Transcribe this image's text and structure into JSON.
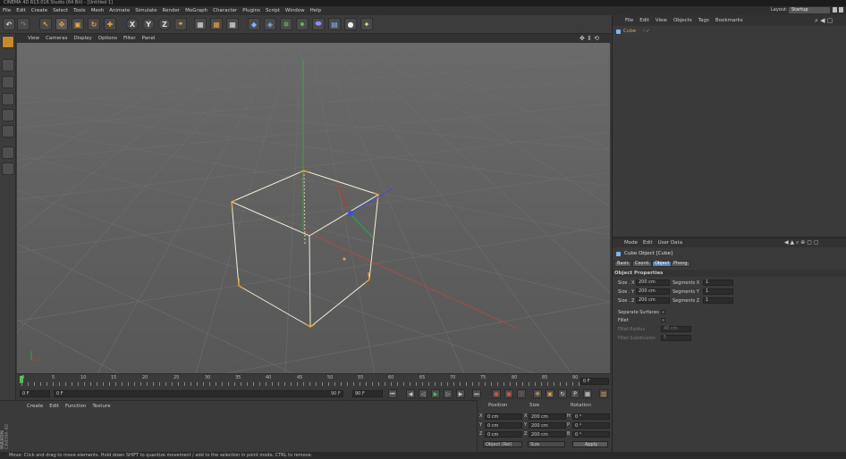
{
  "title_bar": {
    "text": "CINEMA 4D R13.016 Studio (64 Bit) - [Untitled 1]"
  },
  "menu": [
    "File",
    "Edit",
    "Create",
    "Select",
    "Tools",
    "Mesh",
    "Animate",
    "Simulate",
    "Render",
    "MoGraph",
    "Character",
    "Plugins",
    "Script",
    "Window",
    "Help"
  ],
  "layout": {
    "label": "Layout:",
    "value": "Startup"
  },
  "toolbar": {
    "axis_x": "X",
    "axis_y": "Y",
    "axis_z": "Z"
  },
  "viewport": {
    "menu": [
      "View",
      "Cameras",
      "Display",
      "Options",
      "Filter",
      "Panel"
    ]
  },
  "timeline": {
    "ticks": [
      "0",
      "5",
      "10",
      "15",
      "20",
      "25",
      "30",
      "35",
      "40",
      "45",
      "50",
      "55",
      "60",
      "65",
      "70",
      "75",
      "80",
      "85",
      "90"
    ],
    "current_frame": "0 F"
  },
  "playback": {
    "start_field": "0 F",
    "min_field": "0 F",
    "max_field": "90 F",
    "end_field": "90 F"
  },
  "material_manager": {
    "menu": [
      "Create",
      "Edit",
      "Function",
      "Texture"
    ],
    "brand_line1": "MAXON",
    "brand_line2": "CINEMA 4D"
  },
  "coordinates": {
    "headers": [
      "Position",
      "Size",
      "Rotation"
    ],
    "rows": [
      {
        "axis": "X",
        "pos": "0 cm",
        "size_axis": "X",
        "size": "200 cm",
        "rot_axis": "H",
        "rot": "0 °"
      },
      {
        "axis": "Y",
        "pos": "0 cm",
        "size_axis": "Y",
        "size": "200 cm",
        "rot_axis": "P",
        "rot": "0 °"
      },
      {
        "axis": "Z",
        "pos": "0 cm",
        "size_axis": "Z",
        "size": "200 cm",
        "rot_axis": "B",
        "rot": "0 °"
      }
    ],
    "mode_select": "Object (Rel)",
    "size_select": "Size",
    "apply_label": "Apply"
  },
  "object_manager": {
    "menu": [
      "File",
      "Edit",
      "View",
      "Objects",
      "Tags",
      "Bookmarks"
    ],
    "objects": [
      {
        "name": "Cube"
      }
    ]
  },
  "attribute_manager": {
    "menu": [
      "Mode",
      "Edit",
      "User Data"
    ],
    "object_title": "Cube Object [Cube]",
    "tabs": [
      "Basic",
      "Coord.",
      "Object",
      "Phong"
    ],
    "active_tab": "Object",
    "section_title": "Object Properties",
    "size_rows": [
      {
        "label": "Size . X",
        "value": "200 cm",
        "seg_label": "Segments X",
        "seg": "1"
      },
      {
        "label": "Size . Y",
        "value": "200 cm",
        "seg_label": "Segments Y",
        "seg": "1"
      },
      {
        "label": "Size . Z",
        "value": "200 cm",
        "seg_label": "Segments Z",
        "seg": "1"
      }
    ],
    "separate_surfaces": "Separate Surfaces",
    "fillet": "Fillet",
    "fillet_radius_label": "Fillet Radius",
    "fillet_radius": "40 cm",
    "fillet_subdivision_label": "Fillet Subdivision",
    "fillet_subdivision": "5"
  },
  "status": {
    "text": "Move: Click and drag to move elements. Hold down SHIFT to quantize movement / add to the selection in point mode, CTRL to remove."
  },
  "colors": {
    "accent": "#e8a13a",
    "selection": "#5a7fb0",
    "viewport": "#5d5d5d"
  }
}
